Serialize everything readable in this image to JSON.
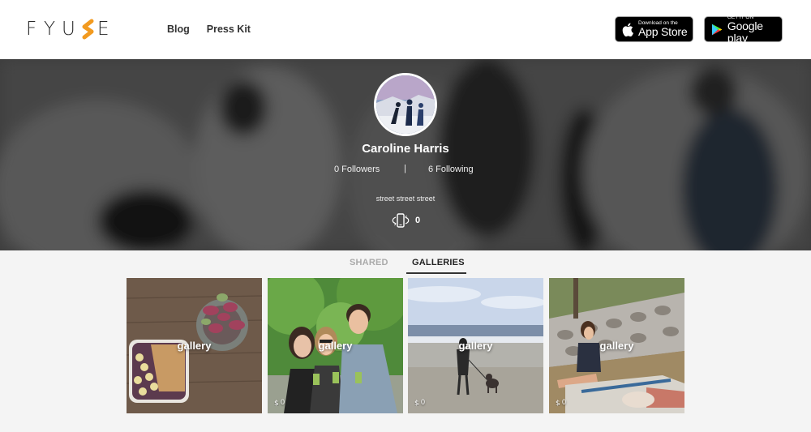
{
  "header": {
    "logo_letters": [
      "F",
      "Y",
      "U",
      "E"
    ],
    "nav": [
      {
        "label": "Blog"
      },
      {
        "label": "Press Kit"
      }
    ],
    "app_store": {
      "small": "Download on the",
      "big": "App Store"
    },
    "google_play": {
      "small": "GET IT ON",
      "big": "Google play"
    }
  },
  "profile": {
    "name": "Caroline Harris",
    "followers": "0 Followers",
    "separator": "|",
    "following": "6 Following",
    "bio": "street street street",
    "fyuse_count": "0"
  },
  "tabs": [
    {
      "label": "SHARED",
      "active": false
    },
    {
      "label": "GALLERIES",
      "active": true
    }
  ],
  "galleries": [
    {
      "label": "gallery",
      "count": ""
    },
    {
      "label": "gallery",
      "count": "0"
    },
    {
      "label": "gallery",
      "count": "0"
    },
    {
      "label": "gallery",
      "count": "0"
    }
  ],
  "colors": {
    "logo_accent": "#f29a1f",
    "header_bg": "#ffffff",
    "tab_active": "#222222",
    "tab_inactive": "#aaaaaa"
  }
}
